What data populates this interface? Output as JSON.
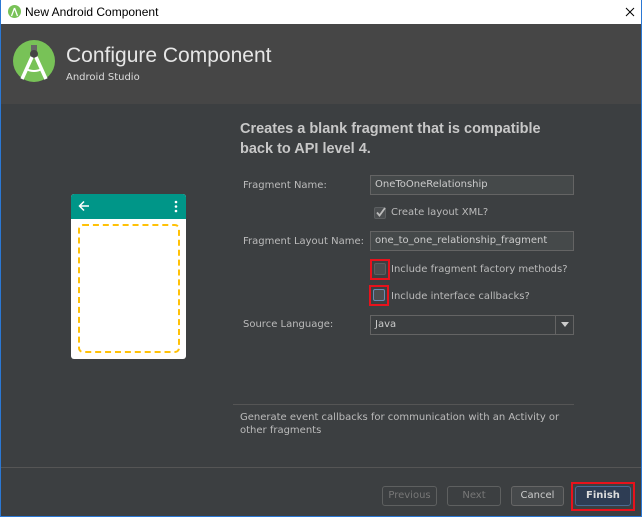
{
  "window": {
    "title": "New Android Component",
    "close_icon": "close-icon"
  },
  "header": {
    "title": "Configure Component",
    "subtitle": "Android Studio",
    "logo_icon": "android-studio-logo"
  },
  "main": {
    "heading": "Creates a blank fragment that is compatible back to API level 4.",
    "preview": {
      "back_icon": "arrow-left-icon",
      "menu_icon": "more-vert-icon",
      "toolbar_color": "#009688",
      "placeholder_color": "#ffc107"
    },
    "fields": {
      "fragment_name_label": "Fragment Name:",
      "fragment_name_value": "OneToOneRelationship",
      "create_layout_label": "Create layout XML?",
      "create_layout_checked": true,
      "layout_name_label": "Fragment Layout Name:",
      "layout_name_value": "one_to_one_relationship_fragment",
      "factory_label": "Include fragment factory methods?",
      "factory_checked": false,
      "callbacks_label": "Include interface callbacks?",
      "callbacks_checked": false,
      "language_label": "Source Language:",
      "language_value": "Java"
    },
    "description": "Generate event callbacks for communication with an Activity or other fragments"
  },
  "buttons": {
    "previous": "Previous",
    "next": "Next",
    "cancel": "Cancel",
    "finish": "Finish"
  },
  "colors": {
    "highlight": "#e8121c",
    "accent": "#2b78d4"
  }
}
